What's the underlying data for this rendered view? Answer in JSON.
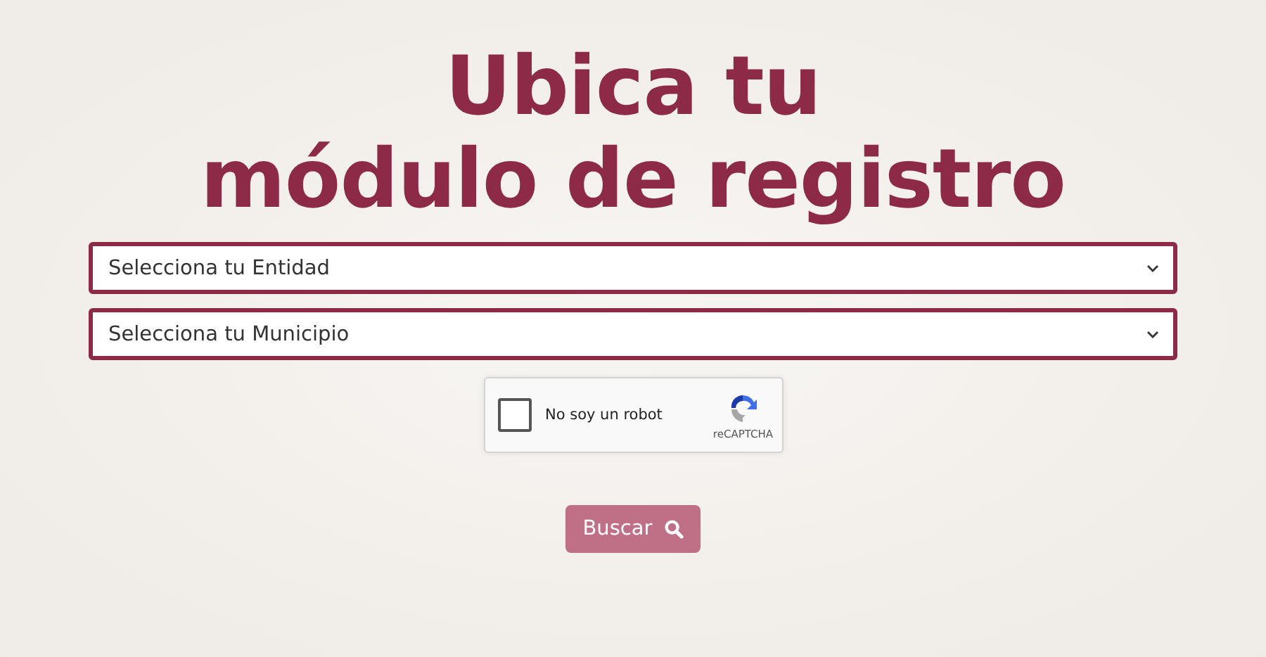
{
  "title": [
    "Ubica tu",
    "módulo de registro"
  ],
  "selects": [
    {
      "placeholder": "Selecciona tu Entidad"
    },
    {
      "placeholder": "Selecciona tu Municipio"
    }
  ],
  "captcha": {
    "label": "No soy un robot",
    "brand": "reCAPTCHA",
    "checked": false
  },
  "search_button": {
    "label": "Buscar",
    "disabled": true
  }
}
